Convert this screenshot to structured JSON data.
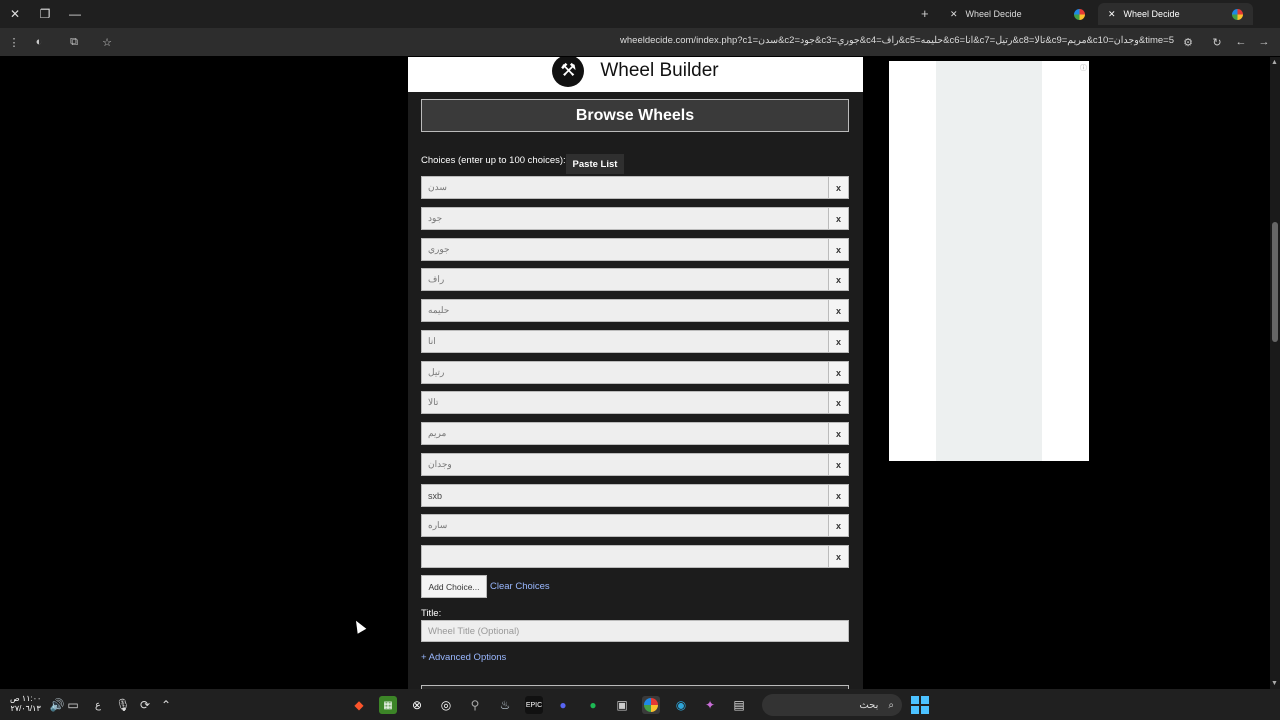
{
  "browser": {
    "tabs": [
      {
        "title": "Wheel Decide",
        "active": false
      },
      {
        "title": "Wheel Decide",
        "active": true
      }
    ],
    "url": "wheeldecide.com/index.php?c1=سدن&c2=جود&c3=جوري&c4=راف&c5=حليمه&c6=انا&c7=رتيل&c8=تالا&c9=مريم&c10=وجدان&time=5"
  },
  "page": {
    "header_title": "Wheel Builder",
    "browse_label": "Browse Wheels",
    "choices_label": "Choices (enter up to 100 choices):",
    "paste_label": "Paste List",
    "choices": [
      "سدن",
      "جود",
      "جوري",
      "راف",
      "حليمه",
      "انا",
      "رتيل",
      "تالا",
      "مريم",
      "وجدان",
      "sxb",
      "ساره",
      ""
    ],
    "remove_label": "x",
    "add_choice_label": "Add Choice...",
    "clear_choices_label": "Clear Choices",
    "title_label": "Title:",
    "title_placeholder": "Wheel Title (Optional)",
    "advanced_label": "+ Advanced Options"
  },
  "taskbar": {
    "time": "١١:٠٠ ص",
    "date": "٢٧/٠٦/١٣",
    "search_placeholder": "بحث",
    "lang": "ع"
  },
  "colors": {
    "page_bg": "#000000",
    "panel_bg": "#1c1c1c",
    "link": "#9ab8ff",
    "taskbar": "#202020"
  }
}
